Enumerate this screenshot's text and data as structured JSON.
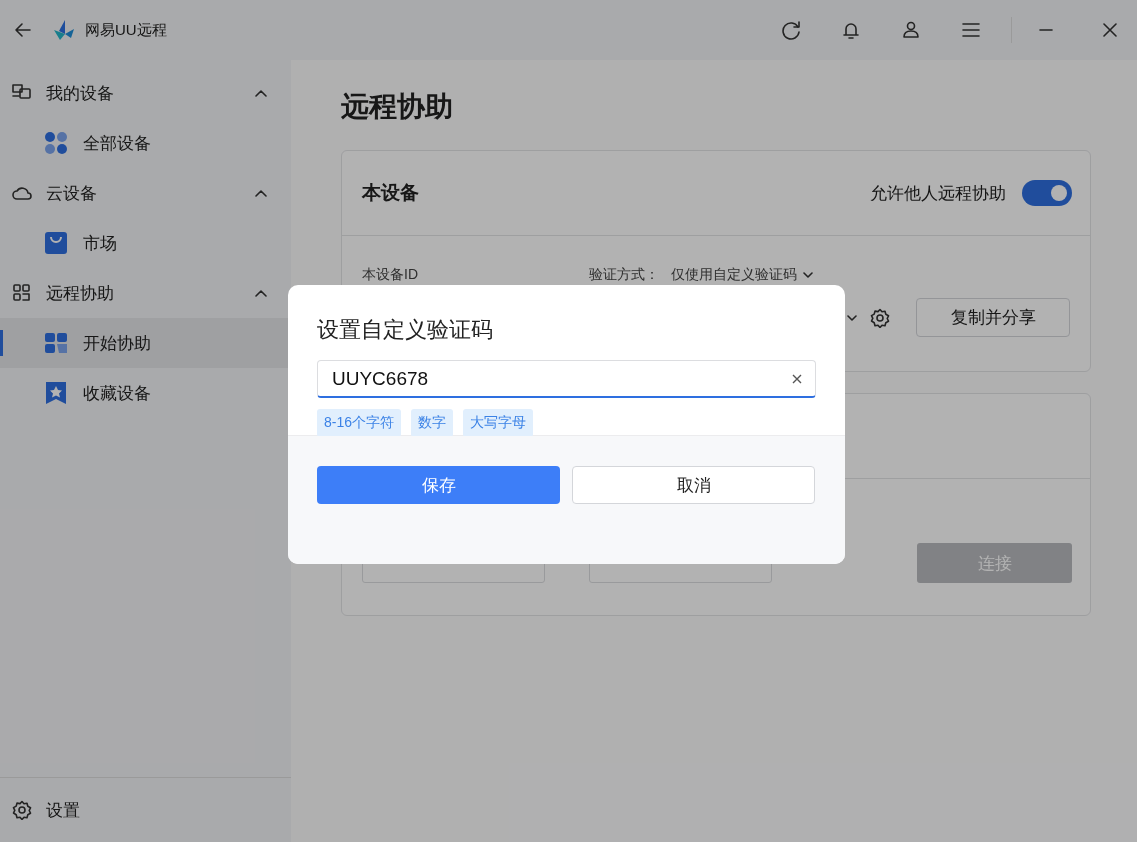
{
  "window": {
    "app_name": "网易UU远程"
  },
  "sidebar": {
    "groups": [
      {
        "label": "我的设备",
        "expanded": true,
        "items": [
          {
            "label": "全部设备",
            "selected": false
          }
        ]
      },
      {
        "label": "云设备",
        "expanded": true,
        "items": [
          {
            "label": "市场",
            "selected": false
          }
        ]
      },
      {
        "label": "远程协助",
        "expanded": true,
        "items": [
          {
            "label": "开始协助",
            "selected": true
          },
          {
            "label": "收藏设备",
            "selected": false
          }
        ]
      }
    ],
    "settings": "设置"
  },
  "main": {
    "title": "远程协助",
    "device_card": {
      "title": "本设备",
      "toggle_label": "允许他人远程协助",
      "toggle_on": true,
      "id_label": "本设备ID",
      "verify_label": "验证方式：",
      "verify_value": "仅使用自定义验证码",
      "share_button": "复制并分享"
    },
    "connect_card": {
      "connect_button": "连接",
      "connect_disabled": true
    }
  },
  "dialog": {
    "title": "设置自定义验证码",
    "value": "UUYC6678",
    "rules": [
      "8-16个字符",
      "数字",
      "大写字母"
    ],
    "save_button": "保存",
    "cancel_button": "取消"
  }
}
